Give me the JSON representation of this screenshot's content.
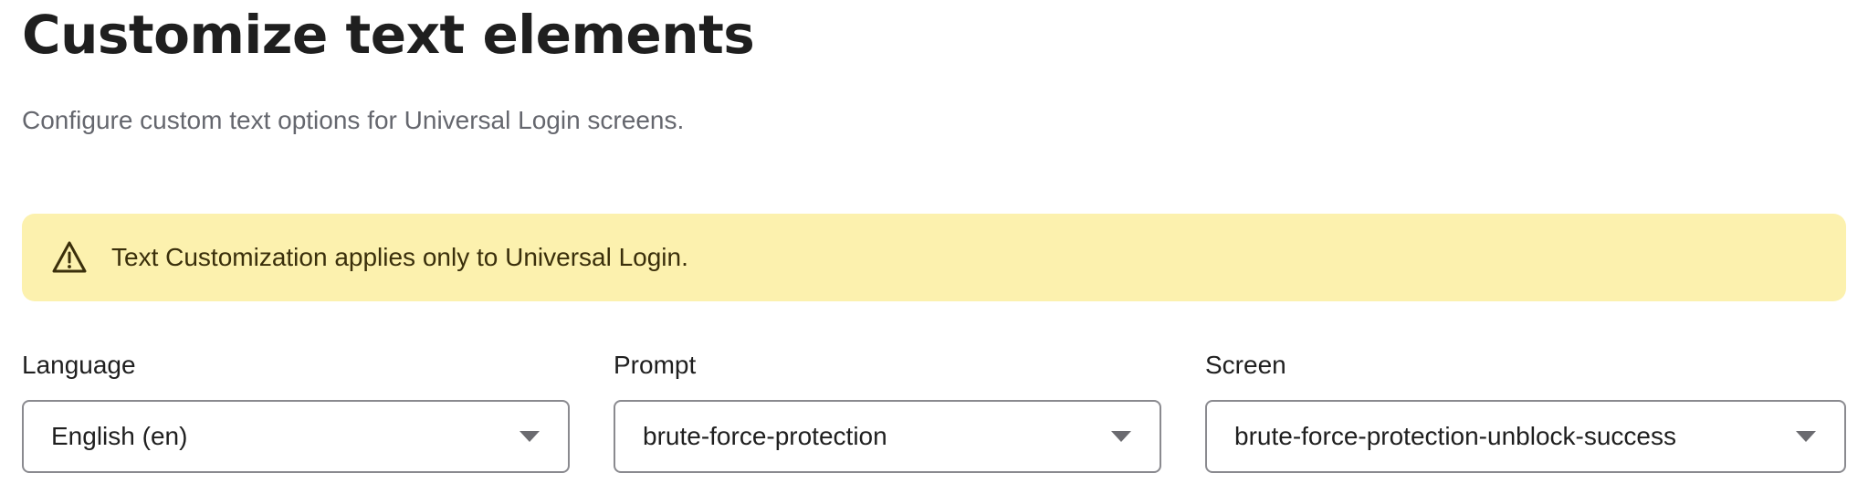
{
  "header": {
    "title": "Customize text elements",
    "subtitle": "Configure custom text options for Universal Login screens."
  },
  "alert": {
    "icon": "warning-triangle-icon",
    "message": "Text Customization applies only to Universal Login.",
    "background_color": "#fcf1ae"
  },
  "filters": {
    "language": {
      "label": "Language",
      "value": "English (en)"
    },
    "prompt": {
      "label": "Prompt",
      "value": "brute-force-protection"
    },
    "screen": {
      "label": "Screen",
      "value": "brute-force-protection-unblock-success"
    }
  }
}
